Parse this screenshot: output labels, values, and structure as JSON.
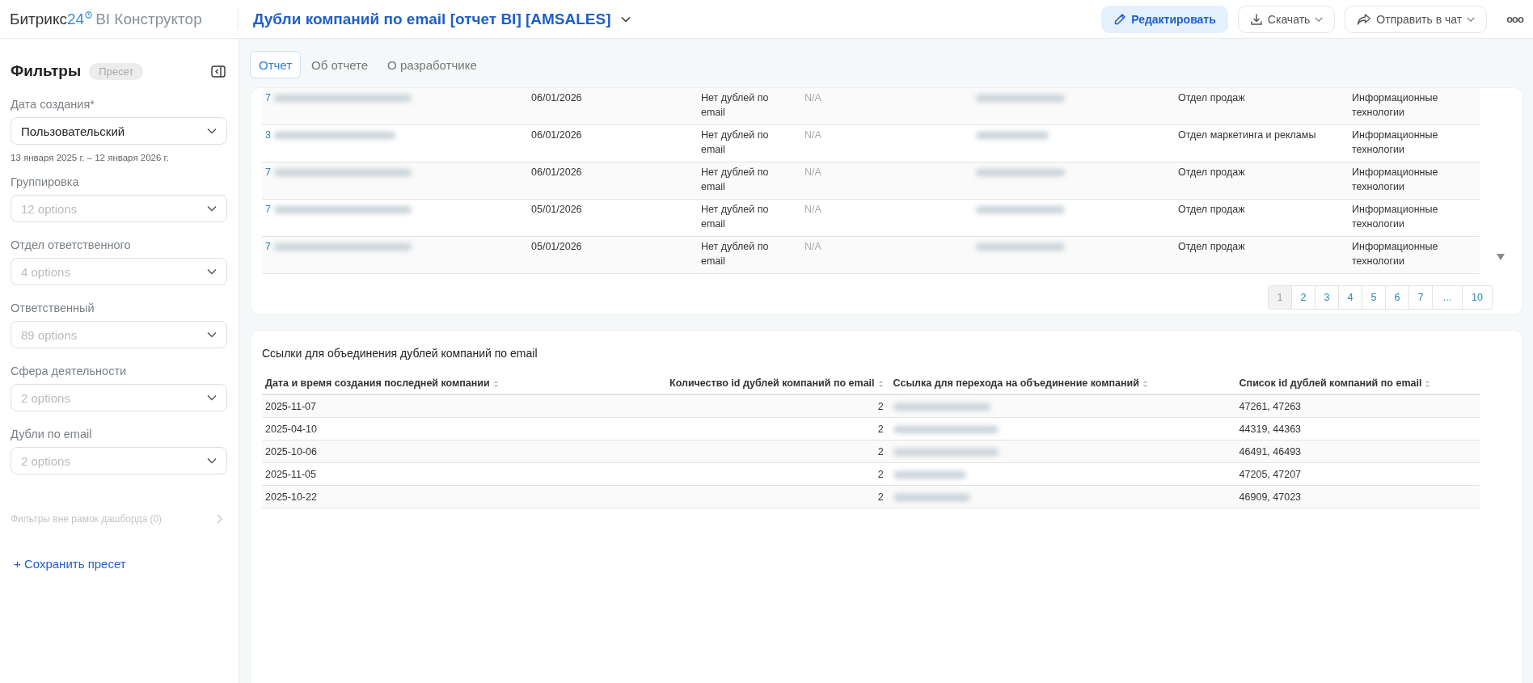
{
  "header": {
    "brand": {
      "name": "Битрикс",
      "number": "24",
      "product": "BI Конструктор"
    },
    "title": "Дубли компаний по email [отчет BI] [AMSALES]",
    "buttons": [
      {
        "kind": "edit",
        "label": "Редактировать"
      },
      {
        "kind": "download",
        "label": "Скачать"
      },
      {
        "kind": "share",
        "label": "Отправить в чат"
      },
      {
        "kind": "more",
        "label": "ooo"
      }
    ]
  },
  "sidebar": {
    "title": "Фильтры",
    "preset_badge": "Пресет",
    "filters": [
      {
        "label": "Дата создания*",
        "value": "Пользовательский",
        "note": "13 января 2025 г. – 12 января 2026 г."
      },
      {
        "label": "Группировка",
        "placeholder": "12 options"
      },
      {
        "label": "Отдел ответственного",
        "placeholder": "4 options"
      },
      {
        "label": "Ответственный",
        "placeholder": "89 options"
      },
      {
        "label": "Сфера деятельности",
        "placeholder": "2 options"
      },
      {
        "label": "Дубли по email",
        "placeholder": "2 options"
      }
    ],
    "outside_filters": "Фильтры вне рамок дашборда (0)",
    "save_preset": "+ Сохранить пресет"
  },
  "tabs": [
    {
      "label": "Отчет",
      "selected": true
    },
    {
      "label": "Об отчете",
      "selected": false
    },
    {
      "label": "О разработчике",
      "selected": false
    }
  ],
  "top_table": {
    "rows": [
      {
        "column_1": "7",
        "column_3": "06/01/2026",
        "column_4": "Нет дублей по email",
        "column_5": "N/A",
        "column_7": "Отдел продаж",
        "column_8": "Информационные технологии"
      },
      {
        "column_1": "3",
        "column_3": "06/01/2026",
        "column_4": "Нет дублей по email",
        "column_5": "N/A",
        "column_7": "Отдел маркетинга и рекламы",
        "column_8": "Информационные технологии"
      },
      {
        "column_1": "7",
        "column_3": "06/01/2026",
        "column_4": "Нет дублей по email",
        "column_5": "N/A",
        "column_7": "Отдел продаж",
        "column_8": "Информационные технологии"
      },
      {
        "column_1": "7",
        "column_3": "05/01/2026",
        "column_4": "Нет дублей по email",
        "column_5": "N/A",
        "column_7": "Отдел продаж",
        "column_8": "Информационные технологии"
      },
      {
        "column_1": "7",
        "column_3": "05/01/2026",
        "column_4": "Нет дублей по email",
        "column_5": "N/A",
        "column_7": "Отдел продаж",
        "column_8": "Информационные технологии"
      }
    ],
    "pages": [
      {
        "label": "1",
        "selected": true
      },
      {
        "label": "2",
        "selected": false
      },
      {
        "label": "3",
        "selected": false
      },
      {
        "label": "4",
        "selected": false
      },
      {
        "label": "5",
        "selected": false
      },
      {
        "label": "6",
        "selected": false
      },
      {
        "label": "7",
        "selected": false
      },
      {
        "label": "...",
        "selected": false
      },
      {
        "label": "10",
        "selected": false
      }
    ]
  },
  "links_table": {
    "title": "Ссылки для объединения дублей компаний по email",
    "columns": [
      "Дата и время создания последней компании",
      "Количество id дублей компаний по email",
      "Ссылка для перехода на объединение компаний",
      "Список id дублей компаний по email"
    ],
    "rows": [
      {
        "date": "2025-11-07",
        "count": "2",
        "ids": "47261, 47263"
      },
      {
        "date": "2025-04-10",
        "count": "2",
        "ids": "44319, 44363"
      },
      {
        "date": "2025-10-06",
        "count": "2",
        "ids": "46491, 46493"
      },
      {
        "date": "2025-11-05",
        "count": "2",
        "ids": "47205, 47207"
      },
      {
        "date": "2025-10-22",
        "count": "2",
        "ids": "46909, 47023"
      }
    ]
  }
}
